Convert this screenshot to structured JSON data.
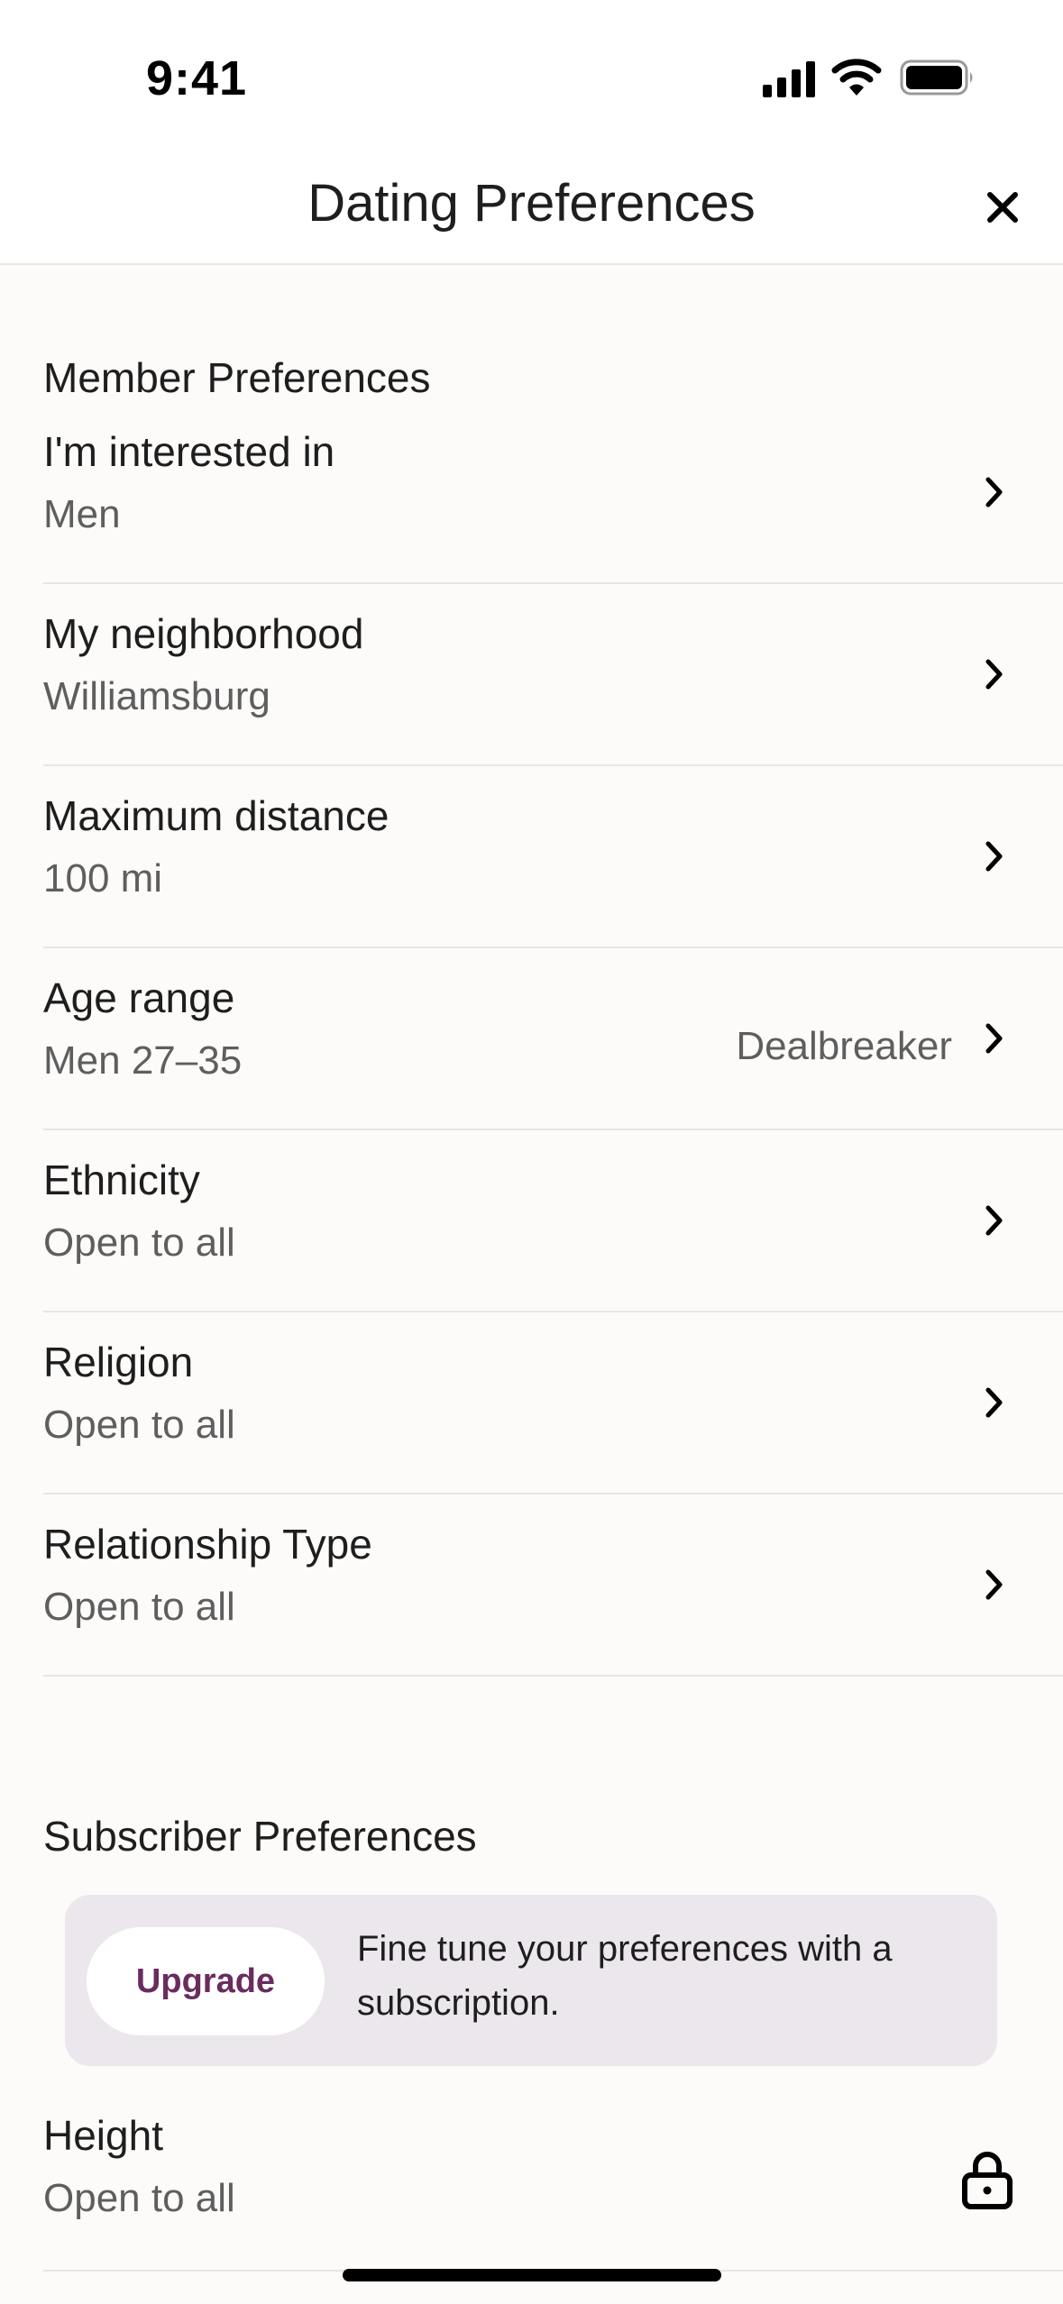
{
  "status_bar": {
    "time": "9:41"
  },
  "header": {
    "title": "Dating Preferences"
  },
  "member_section": {
    "title": "Member Preferences",
    "rows": [
      {
        "label": "I'm interested in",
        "value": "Men"
      },
      {
        "label": "My neighborhood",
        "value": "Williamsburg"
      },
      {
        "label": "Maximum distance",
        "value": "100 mi"
      },
      {
        "label": "Age range",
        "value": "Men 27–35",
        "tag": "Dealbreaker"
      },
      {
        "label": "Ethnicity",
        "value": "Open to all"
      },
      {
        "label": "Religion",
        "value": "Open to all"
      },
      {
        "label": "Relationship Type",
        "value": "Open to all"
      }
    ]
  },
  "subscriber_section": {
    "title": "Subscriber Preferences",
    "upgrade": {
      "button_label": "Upgrade",
      "text": "Fine tune your preferences with a subscription."
    },
    "rows": [
      {
        "label": "Height",
        "value": "Open to all",
        "locked": true
      }
    ]
  },
  "icons": {
    "close": "close-icon",
    "chevron": "chevron-right-icon",
    "lock": "lock-icon"
  },
  "colors": {
    "background": "#FCFBF9",
    "accent": "#6A2C5E",
    "banner": "#ECE7EC",
    "secondary_text": "#5E5E5E"
  }
}
